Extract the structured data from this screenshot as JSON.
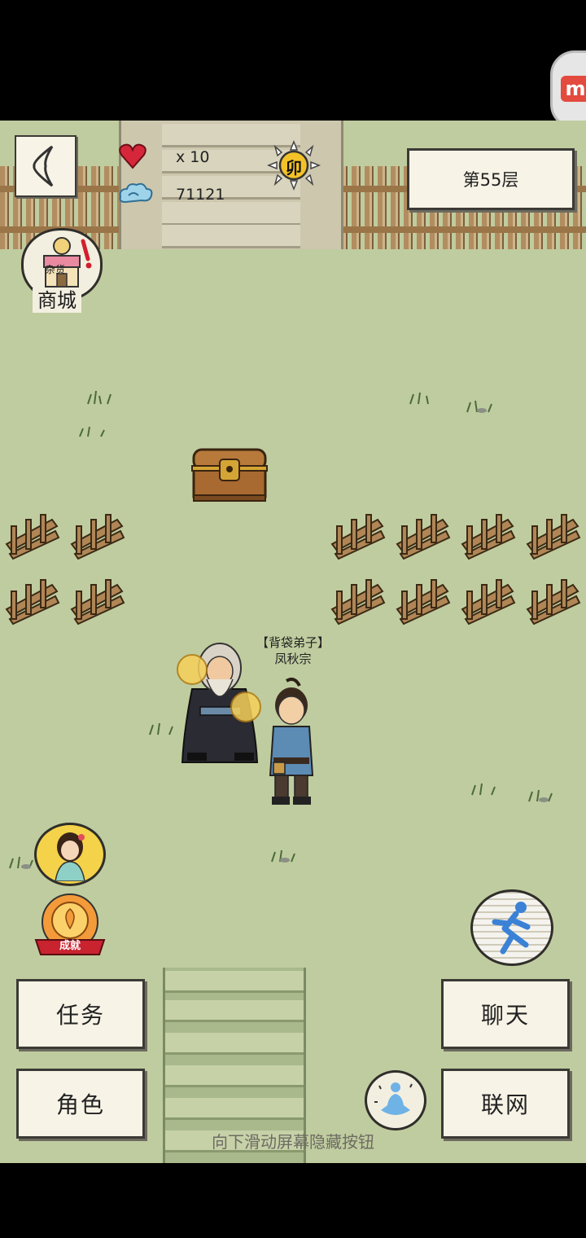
{
  "hud": {
    "lives_text": "x 10",
    "spirit_value": "71121",
    "floor_label": "第55层",
    "day_badge": "卯"
  },
  "shop": {
    "label": "商城",
    "sign_text": "杂货"
  },
  "npc": {
    "title": "【背袋弟子】",
    "name": "凤秋宗"
  },
  "achievement": {
    "label": "成就"
  },
  "buttons": {
    "task": "任务",
    "role": "角色",
    "chat": "聊天",
    "network": "联网"
  },
  "hint": "向下滑动屏幕隐藏按钮",
  "colors": {
    "ground": "#bfcc9f",
    "heart": "#d6273a",
    "chest_gold": "#d4a535"
  }
}
